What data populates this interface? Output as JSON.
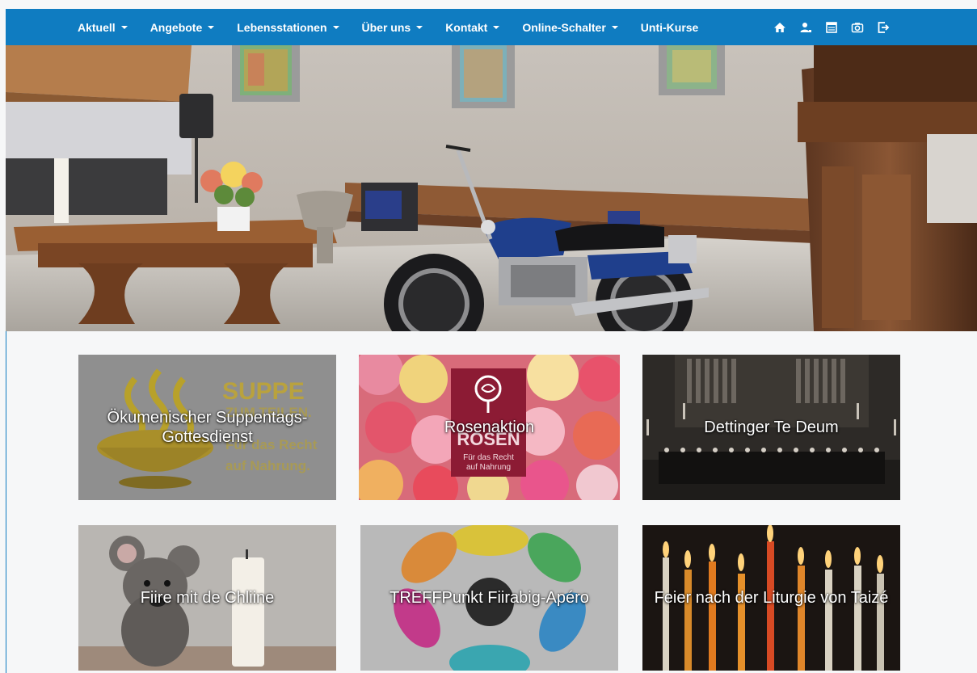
{
  "nav": {
    "items": [
      {
        "label": "Aktuell",
        "dropdown": true
      },
      {
        "label": "Angebote",
        "dropdown": true
      },
      {
        "label": "Lebensstationen",
        "dropdown": true
      },
      {
        "label": "Über uns",
        "dropdown": true
      },
      {
        "label": "Kontakt",
        "dropdown": true
      },
      {
        "label": "Online-Schalter",
        "dropdown": true
      },
      {
        "label": "Unti-Kurse",
        "dropdown": false
      }
    ],
    "icons": [
      "home-icon",
      "user-icon",
      "calendar-icon",
      "camera-icon",
      "logout-icon"
    ]
  },
  "colors": {
    "nav_bg": "#0f7cc1",
    "page_bg": "#f6f7f8",
    "caption_text": "#ffffff"
  },
  "hero": {
    "icon": "church-interior-motorcycle-image"
  },
  "tiles": [
    {
      "caption": "Ökumenischer Suppentags-Gottesdienst",
      "image": "suppe-zum-teilen-image",
      "image_text": [
        "SUPPE",
        "ZUM TEILEN.",
        "Für das Recht",
        "auf Nahrung."
      ]
    },
    {
      "caption": "Rosenaktion",
      "image": "roses-image",
      "image_text": [
        "ROSEN",
        "Für das Recht",
        "auf Nahrung"
      ]
    },
    {
      "caption": "Dettinger Te Deum",
      "image": "choir-organ-image"
    },
    {
      "caption": "Fiire mit de Chliine",
      "image": "toy-mouse-candle-image"
    },
    {
      "caption": "TREFFPunkt Fiirabig-Apéro",
      "image": "treffpunkt-logo-image"
    },
    {
      "caption": "Feier nach der Liturgie von Taizé",
      "image": "candles-image"
    }
  ]
}
